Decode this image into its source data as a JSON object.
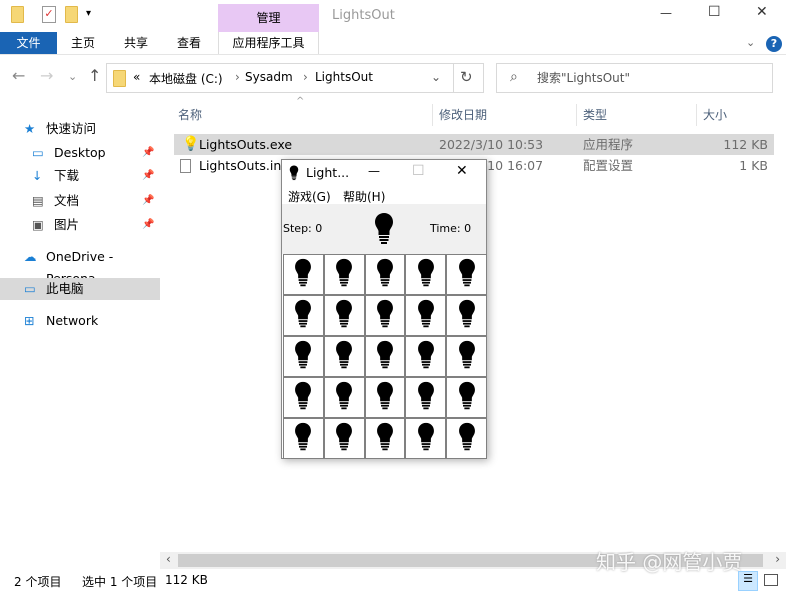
{
  "window": {
    "title": "LightsOut",
    "context_tab": "管理",
    "minimize": "—",
    "maximize": "☐",
    "close": "✕"
  },
  "ribbon": {
    "tabs": [
      "文件",
      "主页",
      "共享",
      "查看",
      "应用程序工具"
    ]
  },
  "address": {
    "prefix": "«",
    "crumbs": [
      "本地磁盘 (C:)",
      "Sysadm",
      "LightsOut"
    ],
    "search_placeholder": "搜索\"LightsOut\""
  },
  "columns": [
    "名称",
    "修改日期",
    "类型",
    "大小"
  ],
  "sidebar": [
    {
      "label": "快速访问",
      "icon": "star-icon"
    },
    {
      "label": "Desktop",
      "icon": "desktop-icon"
    },
    {
      "label": "下载",
      "icon": "download-icon"
    },
    {
      "label": "文档",
      "icon": "document-icon"
    },
    {
      "label": "图片",
      "icon": "picture-icon"
    },
    {
      "label": "OneDrive - Persona",
      "icon": "cloud-icon"
    },
    {
      "label": "此电脑",
      "icon": "computer-icon"
    },
    {
      "label": "Network",
      "icon": "network-icon"
    }
  ],
  "files": [
    {
      "name": "LightsOuts.exe",
      "date": "2022/3/10 10:53",
      "type": "应用程序",
      "size": "112 KB"
    },
    {
      "name": "LightsOuts.ini",
      "date": "2022/3/10 16:07",
      "type": "配置设置",
      "size": "1 KB"
    }
  ],
  "dialog": {
    "title": "Light...",
    "menu": [
      "游戏(G)",
      "帮助(H)"
    ],
    "step": "Step: 0",
    "time": "Time: 0",
    "grid": [
      [
        1,
        1,
        1,
        1,
        1
      ],
      [
        1,
        1,
        1,
        1,
        1
      ],
      [
        1,
        1,
        1,
        1,
        1
      ],
      [
        1,
        1,
        1,
        1,
        1
      ],
      [
        1,
        1,
        1,
        1,
        1
      ]
    ]
  },
  "status": {
    "count": "2 个项目",
    "selected": "选中 1 个项目",
    "size": "112 KB"
  },
  "watermark": "知乎 @网管小贾"
}
